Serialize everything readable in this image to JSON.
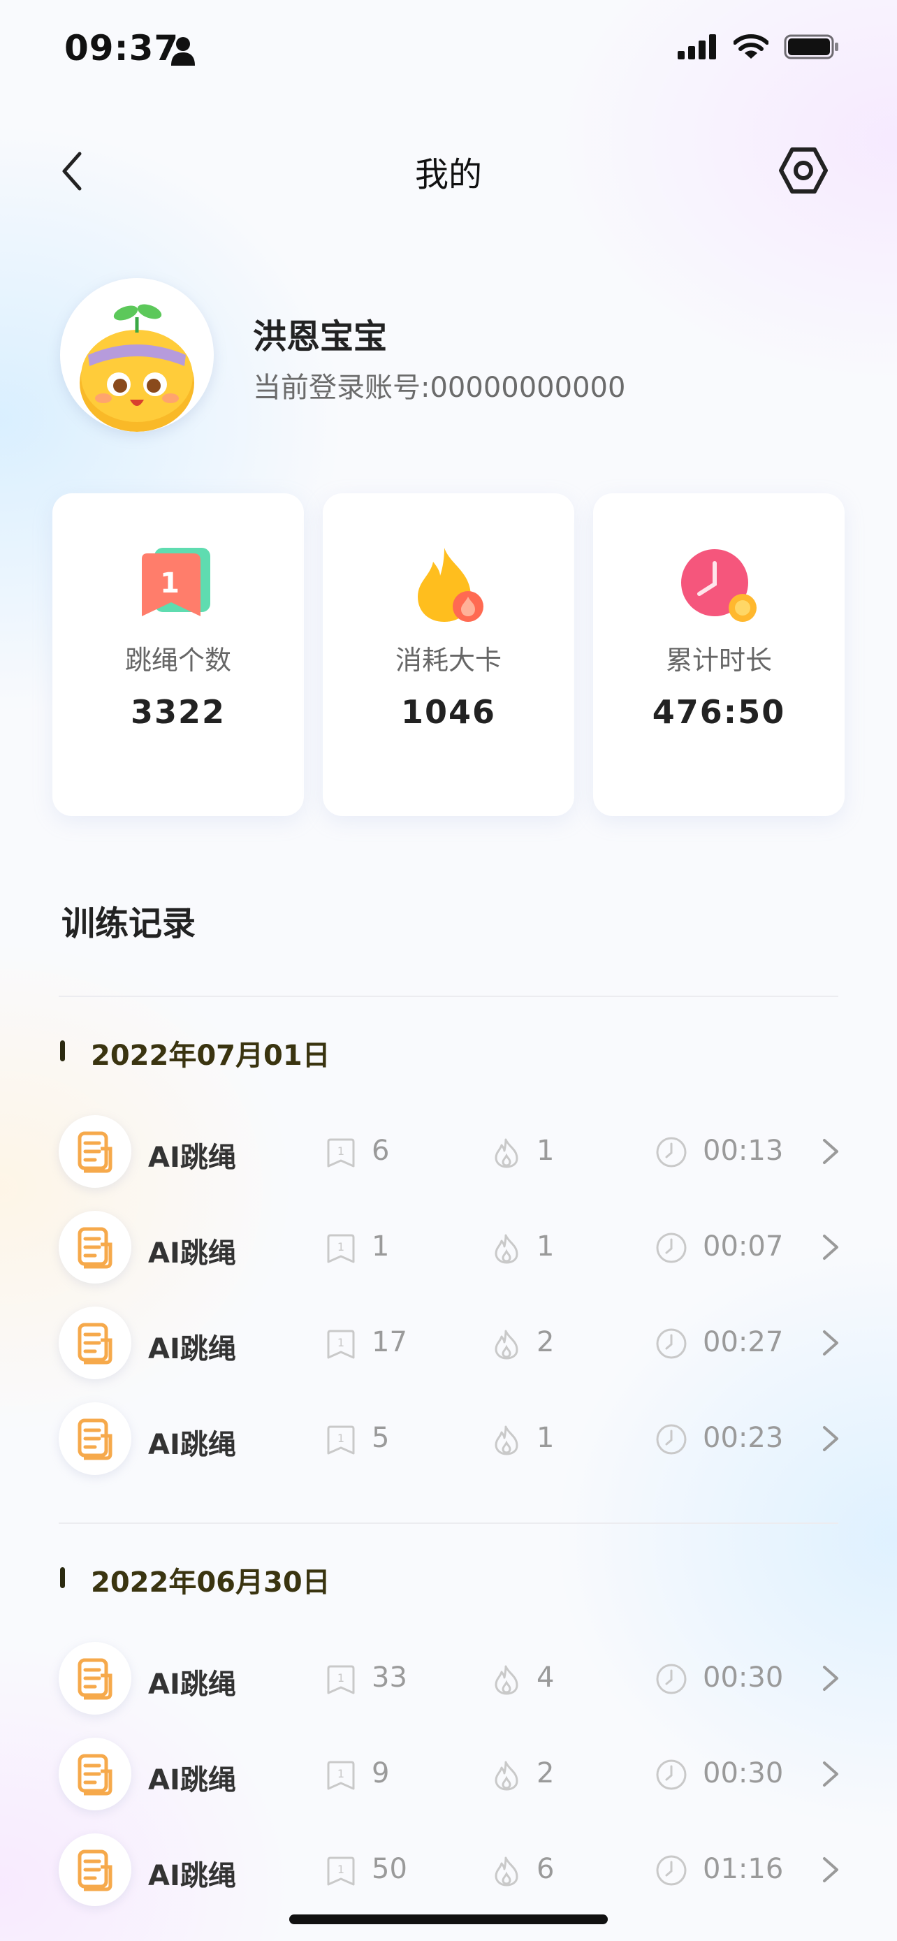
{
  "status_bar": {
    "time": "09:37"
  },
  "nav": {
    "title": "我的"
  },
  "profile": {
    "name": "洪恩宝宝",
    "account": "当前登录账号:00000000000"
  },
  "stats": [
    {
      "label": "跳绳个数",
      "value": "3322",
      "icon": "jump-count-icon"
    },
    {
      "label": "消耗大卡",
      "value": "1046",
      "icon": "fire-icon"
    },
    {
      "label": "累计时长",
      "value": "476:50",
      "icon": "clock-icon"
    }
  ],
  "records": {
    "title": "训练记录",
    "groups": [
      {
        "date": "2022年07月01日",
        "items": [
          {
            "name": "AI跳绳",
            "count": "6",
            "kcal": "1",
            "duration": "00:13"
          },
          {
            "name": "AI跳绳",
            "count": "1",
            "kcal": "1",
            "duration": "00:07"
          },
          {
            "name": "AI跳绳",
            "count": "17",
            "kcal": "2",
            "duration": "00:27"
          },
          {
            "name": "AI跳绳",
            "count": "5",
            "kcal": "1",
            "duration": "00:23"
          }
        ]
      },
      {
        "date": "2022年06月30日",
        "items": [
          {
            "name": "AI跳绳",
            "count": "33",
            "kcal": "4",
            "duration": "00:30"
          },
          {
            "name": "AI跳绳",
            "count": "9",
            "kcal": "2",
            "duration": "00:30"
          },
          {
            "name": "AI跳绳",
            "count": "50",
            "kcal": "6",
            "duration": "01:16"
          }
        ]
      }
    ]
  },
  "colors": {
    "accent_orange": "#f6a94b",
    "date_bar": "#2b2a10",
    "muted": "#9a9a9a"
  }
}
